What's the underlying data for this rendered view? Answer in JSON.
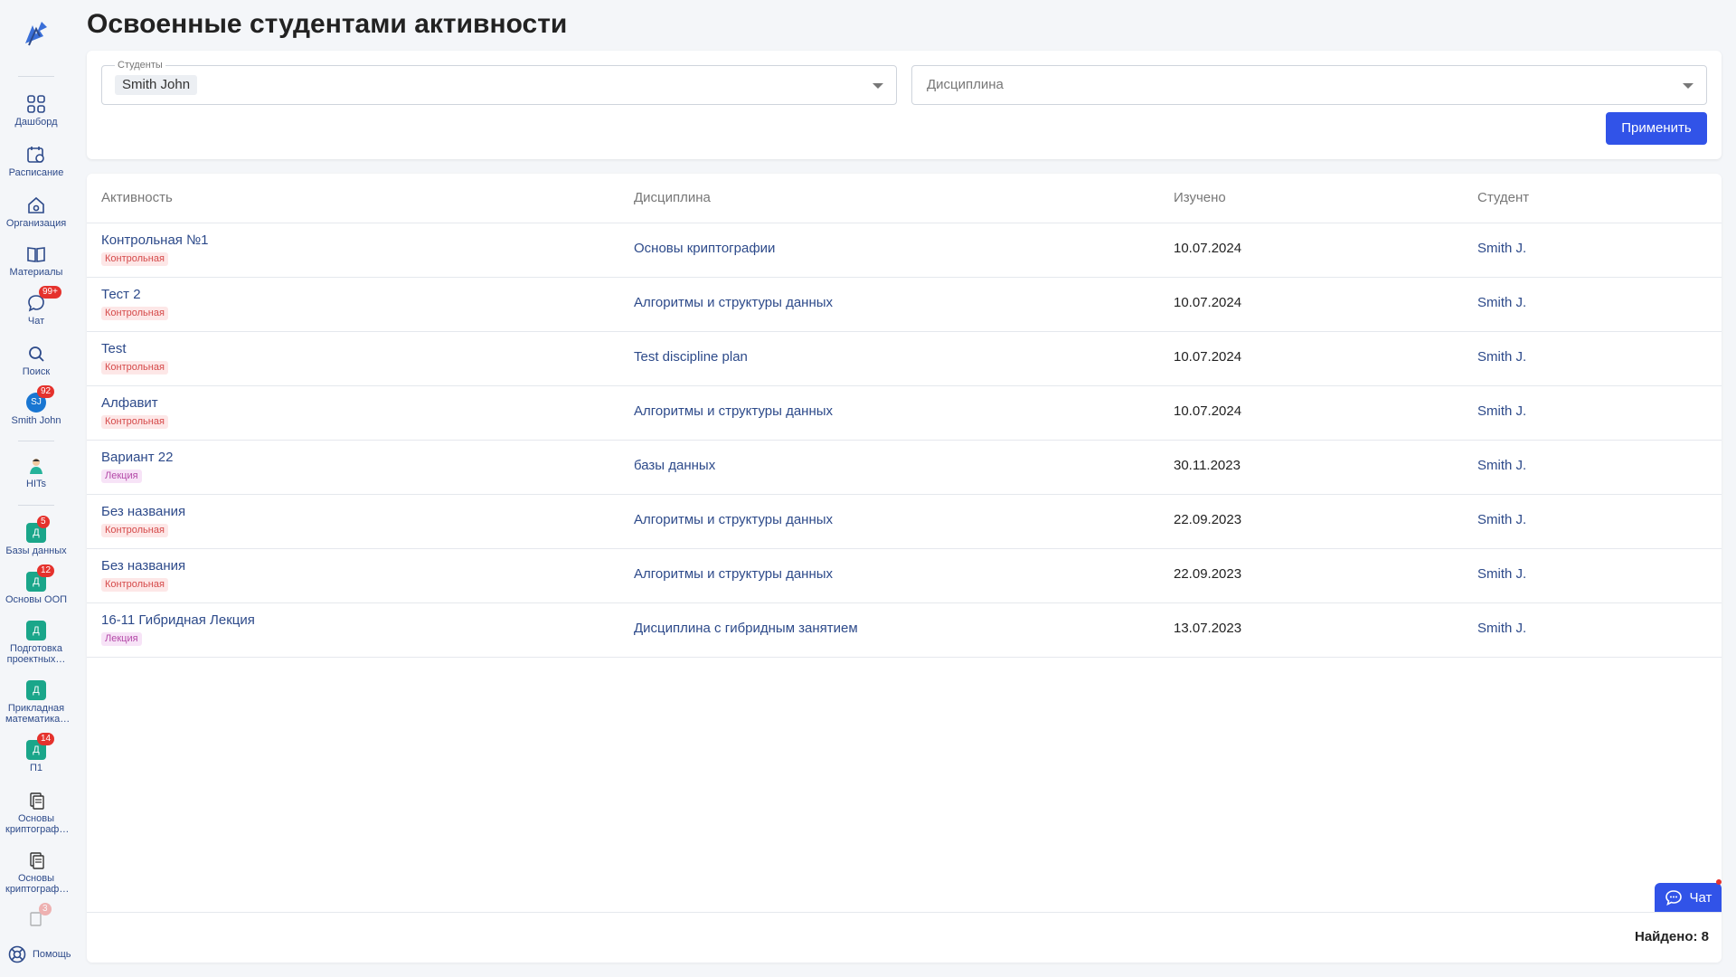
{
  "sidebar": {
    "items": [
      {
        "label": "Дашборд",
        "icon": "grid-icon"
      },
      {
        "label": "Расписание",
        "icon": "calendar-icon"
      },
      {
        "label": "Организация",
        "icon": "building-icon"
      },
      {
        "label": "Материалы",
        "icon": "book-icon"
      },
      {
        "label": "Чат",
        "icon": "chat-icon",
        "badge": "99+"
      },
      {
        "label": "Поиск",
        "icon": "search-icon"
      },
      {
        "label": "Smith John",
        "avatar": "SJ",
        "badge": "92"
      },
      {
        "label": "HITs",
        "icon": "mascot-icon"
      }
    ],
    "courses": [
      {
        "letter": "Д",
        "label": "Базы данных",
        "badge": "5"
      },
      {
        "letter": "Д",
        "label": "Основы ООП",
        "badge": "12"
      },
      {
        "letter": "Д",
        "label": "Подготовка проектных…",
        "badge": ""
      },
      {
        "letter": "Д",
        "label": "Прикладная математика…",
        "badge": ""
      },
      {
        "letter": "Д",
        "label": "П1",
        "badge": "14"
      },
      {
        "letter": "",
        "label": "Основы криптограф…",
        "badge": ""
      },
      {
        "letter": "",
        "label": "Основы криптограф…",
        "badge": ""
      }
    ],
    "partial_badge": "3",
    "help_label": "Помощь"
  },
  "page": {
    "title": "Освоенные студентами активности"
  },
  "filters": {
    "students_legend": "Студенты",
    "students_chip": "Smith John",
    "discipline_placeholder": "Дисциплина",
    "apply_label": "Применить"
  },
  "table": {
    "headers": [
      "Активность",
      "Дисциплина",
      "Изучено",
      "Студент"
    ],
    "rows": [
      {
        "activity": "Контрольная №1",
        "type": "Контрольная",
        "type_kind": "control",
        "discipline": "Основы криптографии",
        "date": "10.07.2024",
        "student": "Smith J."
      },
      {
        "activity": "Тест 2",
        "type": "Контрольная",
        "type_kind": "control",
        "discipline": "Алгоритмы и структуры данных",
        "date": "10.07.2024",
        "student": "Smith J."
      },
      {
        "activity": "Test",
        "type": "Контрольная",
        "type_kind": "control",
        "discipline": "Test discipline plan",
        "date": "10.07.2024",
        "student": "Smith J."
      },
      {
        "activity": "Алфавит",
        "type": "Контрольная",
        "type_kind": "control",
        "discipline": "Алгоритмы и структуры данных",
        "date": "10.07.2024",
        "student": "Smith J."
      },
      {
        "activity": "Вариант 22",
        "type": "Лекция",
        "type_kind": "lecture",
        "discipline": "базы данных",
        "date": "30.11.2023",
        "student": "Smith J."
      },
      {
        "activity": "Без названия",
        "type": "Контрольная",
        "type_kind": "control",
        "discipline": "Алгоритмы и структуры данных",
        "date": "22.09.2023",
        "student": "Smith J."
      },
      {
        "activity": "Без названия",
        "type": "Контрольная",
        "type_kind": "control",
        "discipline": "Алгоритмы и структуры данных",
        "date": "22.09.2023",
        "student": "Smith J."
      },
      {
        "activity": "16-11 Гибридная Лекция",
        "type": "Лекция",
        "type_kind": "lecture",
        "discipline": "Дисциплина с гибридным занятием",
        "date": "13.07.2023",
        "student": "Smith J."
      }
    ],
    "found_label": "Найдено: 8"
  },
  "chat_widget": {
    "label": "Чат"
  },
  "colors": {
    "accent": "#3153e8",
    "link": "#2d4a8a",
    "course": "#1aa68a",
    "badge": "#e5322d"
  }
}
